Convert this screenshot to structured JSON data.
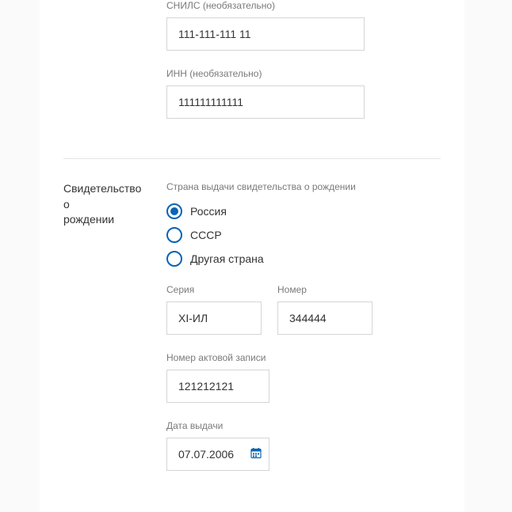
{
  "identity": {
    "snils_label": "СНИЛС (необязательно)",
    "snils_value": "111-111-111 11",
    "inn_label": "ИНН (необязательно)",
    "inn_value": "111111111111"
  },
  "birth_cert": {
    "section_title_line1": "Свидетельство о",
    "section_title_line2": "рождении",
    "country_label": "Страна выдачи свидетельства о рождении",
    "options": {
      "russia": "Россия",
      "ussr": "СССР",
      "other": "Другая страна"
    },
    "selected": "russia",
    "series_label": "Серия",
    "series_value": "XI-ИЛ",
    "number_label": "Номер",
    "number_value": "344444",
    "act_label": "Номер актовой записи",
    "act_value": "121212121",
    "issue_date_label": "Дата выдачи",
    "issue_date_value": "07.07.2006"
  }
}
